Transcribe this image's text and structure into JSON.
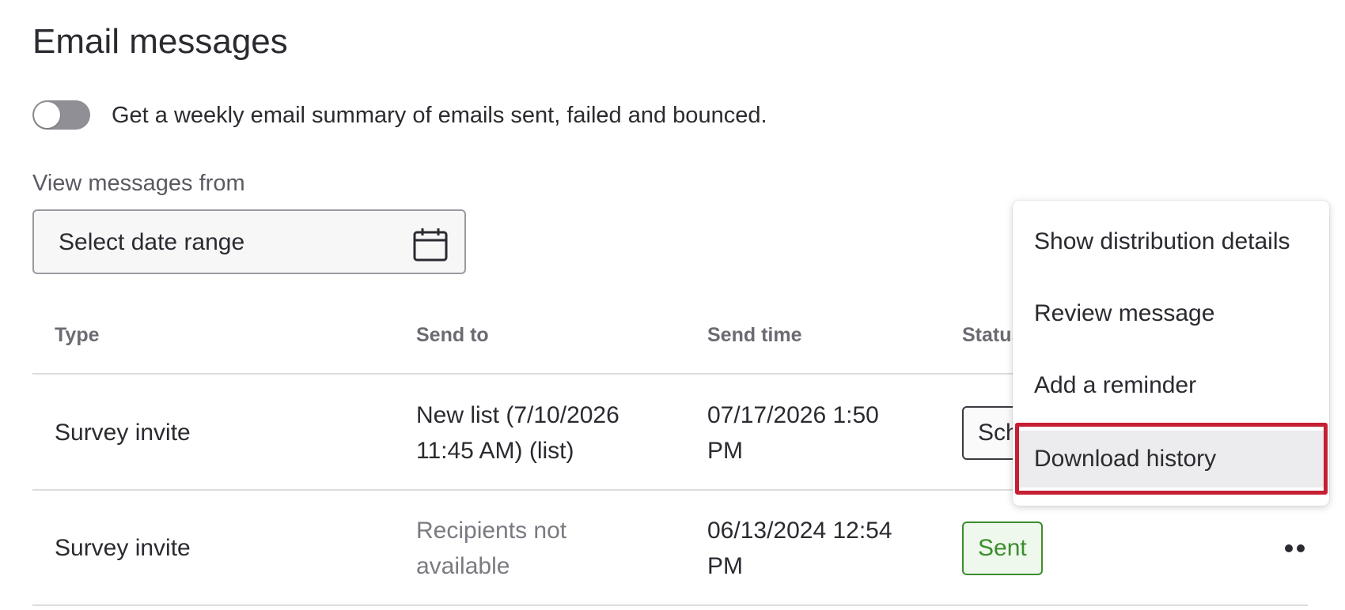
{
  "page": {
    "title": "Email messages"
  },
  "summary_toggle": {
    "label": "Get a weekly email summary of emails sent, failed and bounced.",
    "enabled": false
  },
  "filter": {
    "label": "View messages from",
    "placeholder": "Select date range",
    "icon": "calendar-icon"
  },
  "table": {
    "columns": [
      "Type",
      "Send to",
      "Send time",
      "Status"
    ],
    "rows": [
      {
        "type": "Survey invite",
        "send_to": [
          "New list (7/10/2026",
          "11:45 AM) (list)"
        ],
        "send_time": [
          "07/17/2026 1:50",
          "PM"
        ],
        "status": "Sch"
      },
      {
        "type": "Survey invite",
        "send_to": [
          "Recipients not",
          "available"
        ],
        "send_time": [
          "06/13/2024 12:54",
          "PM"
        ],
        "status": "Sent"
      }
    ]
  },
  "context_menu": {
    "items": [
      "Show distribution details",
      "Review message",
      "Add a reminder",
      "Download history"
    ],
    "highlighted_index": 3
  },
  "colors": {
    "sent": "#3c8d2f",
    "highlight": "#c51f33",
    "toggle_off": "#8f8f95"
  }
}
